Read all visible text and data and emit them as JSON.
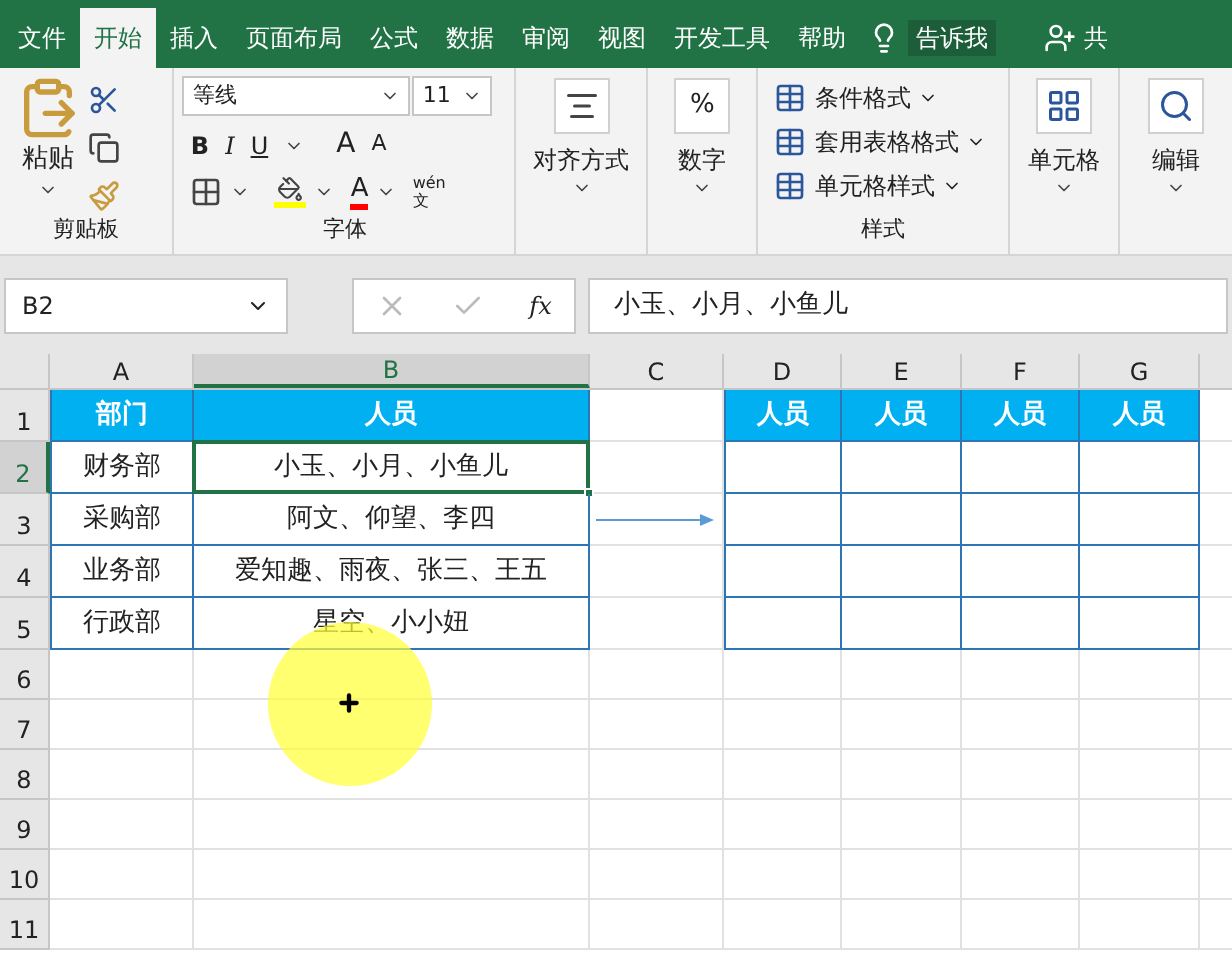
{
  "tabs": [
    {
      "label": "文件",
      "selected": false
    },
    {
      "label": "开始",
      "selected": true
    },
    {
      "label": "插入",
      "selected": false
    },
    {
      "label": "页面布局",
      "selected": false
    },
    {
      "label": "公式",
      "selected": false
    },
    {
      "label": "数据",
      "selected": false
    },
    {
      "label": "审阅",
      "selected": false
    },
    {
      "label": "视图",
      "selected": false
    },
    {
      "label": "开发工具",
      "selected": false
    },
    {
      "label": "帮助",
      "selected": false
    }
  ],
  "tell_me": "告诉我",
  "share": "共",
  "ribbon": {
    "clipboard": {
      "paste": "粘贴",
      "label": "剪贴板"
    },
    "font": {
      "font_name": "等线",
      "font_size": "11",
      "bold": "B",
      "italic": "I",
      "underline": "U",
      "grow": "A",
      "shrink": "A",
      "font_color": "A",
      "phonetic_top": "wén",
      "phonetic_bottom": "文",
      "label": "字体"
    },
    "alignment": "对齐方式",
    "number": {
      "symbol": "%",
      "label": "数字"
    },
    "styles": {
      "items": [
        "条件格式",
        "套用表格格式",
        "单元格样式"
      ],
      "label": "样式"
    },
    "cells": "单元格",
    "editing": "编辑"
  },
  "formula_bar": {
    "name_box": "B2",
    "fx": "fx",
    "formula": "小玉、小月、小鱼儿"
  },
  "columns": [
    {
      "label": "A",
      "selected": false
    },
    {
      "label": "B",
      "selected": true
    },
    {
      "label": "C",
      "selected": false
    },
    {
      "label": "D",
      "selected": false
    },
    {
      "label": "E",
      "selected": false
    },
    {
      "label": "F",
      "selected": false
    },
    {
      "label": "G",
      "selected": false
    }
  ],
  "rows": [
    {
      "label": "1",
      "selected": false
    },
    {
      "label": "2",
      "selected": true
    },
    {
      "label": "3",
      "selected": false
    },
    {
      "label": "4",
      "selected": false
    },
    {
      "label": "5",
      "selected": false
    },
    {
      "label": "6",
      "selected": false
    },
    {
      "label": "7",
      "selected": false
    },
    {
      "label": "8",
      "selected": false
    },
    {
      "label": "9",
      "selected": false
    },
    {
      "label": "10",
      "selected": false
    },
    {
      "label": "11",
      "selected": false
    }
  ],
  "source_table": {
    "headers": [
      "部门",
      "人员"
    ],
    "rows": [
      [
        "财务部",
        "小玉、小月、小鱼儿"
      ],
      [
        "采购部",
        "阿文、仰望、李四"
      ],
      [
        "业务部",
        "爱知趣、雨夜、张三、王五"
      ],
      [
        "行政部",
        "星空、小小妞"
      ]
    ]
  },
  "target_table": {
    "headers": [
      "人员",
      "人员",
      "人员",
      "人员"
    ]
  }
}
